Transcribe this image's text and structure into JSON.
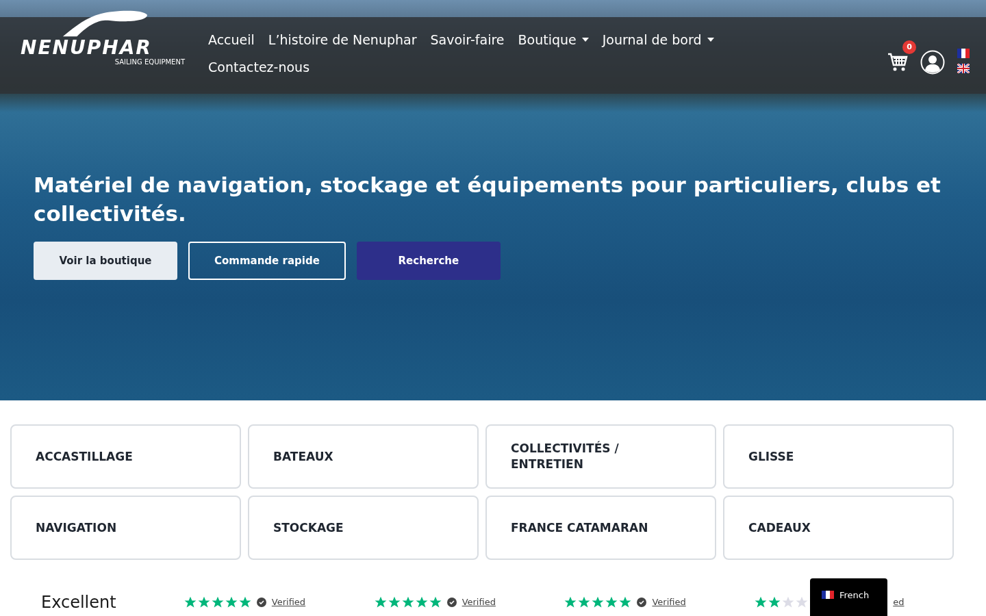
{
  "logo": {
    "wordmark": "NENUPHAR",
    "tagline": "SAILING EQUIPMENT"
  },
  "nav": [
    {
      "label": "Accueil",
      "dropdown": false
    },
    {
      "label": "L’histoire de Nenuphar",
      "dropdown": false
    },
    {
      "label": "Savoir-faire",
      "dropdown": false
    },
    {
      "label": "Boutique",
      "dropdown": true
    },
    {
      "label": "Journal de bord",
      "dropdown": true
    },
    {
      "label": "Contactez-nous",
      "dropdown": false
    }
  ],
  "cart": {
    "count": "0"
  },
  "languages": [
    {
      "kind": "fr"
    },
    {
      "kind": "uk"
    }
  ],
  "hero": {
    "title": "Matériel de navigation, stockage et équipements pour particuliers, clubs et collectivités.",
    "buttons": [
      {
        "label": "Voir la boutique",
        "kind": "light"
      },
      {
        "label": "Commande rapide",
        "kind": "outline"
      },
      {
        "label": "Recherche",
        "kind": "solid"
      }
    ]
  },
  "categories": [
    "ACCASTILLAGE",
    "BATEAUX",
    "COLLECTIVITÉS / ENTRETIEN",
    "GLISSE",
    "NAVIGATION",
    "STOCKAGE",
    "FRANCE CATAMARAN",
    "CADEAUX"
  ],
  "reviews": {
    "rating": "Excellent",
    "items": [
      {
        "stars": 5,
        "check": true,
        "label": "Verified"
      },
      {
        "stars": 5,
        "check": true,
        "label": "Verified"
      },
      {
        "stars": 5,
        "check": true,
        "label": "Verified"
      },
      {
        "stars": 2,
        "check": false,
        "label": "ed"
      }
    ]
  },
  "language_switcher": {
    "label": "French"
  }
}
